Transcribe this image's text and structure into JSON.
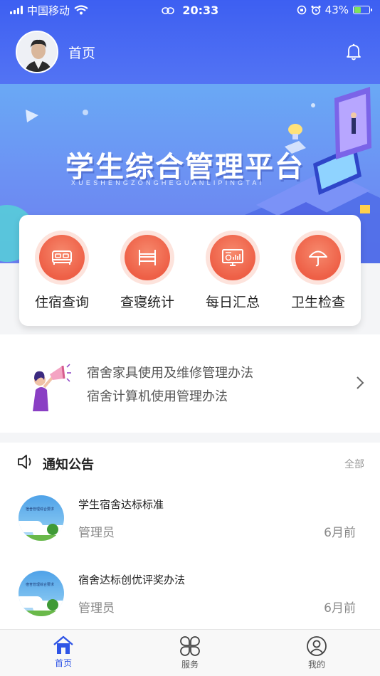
{
  "status_bar": {
    "carrier": "中国移动",
    "time": "20:33",
    "battery": "43%",
    "battery_level": 0.43
  },
  "header": {
    "title": "首页"
  },
  "banner": {
    "title": "学生综合管理平台",
    "subtitle": "XUESHENGZONGHEGUANLIPINGTAI"
  },
  "quick_menu": [
    {
      "label": "住宿查询",
      "icon": "bed-icon"
    },
    {
      "label": "查寝统计",
      "icon": "bunk-bed-icon"
    },
    {
      "label": "每日汇总",
      "icon": "monitor-chart-icon"
    },
    {
      "label": "卫生检查",
      "icon": "umbrella-icon"
    }
  ],
  "rules": {
    "line1": "宿舍家具使用及维修管理办法",
    "line2": "宿舍计算机使用管理办法"
  },
  "notices": {
    "title": "通知公告",
    "all_label": "全部",
    "items": [
      {
        "thumb_label": "宿舍管理综合要求",
        "title": "学生宿舍达标标准",
        "author": "管理员",
        "time": "6月前"
      },
      {
        "thumb_label": "宿舍管理综合要求",
        "title": "宿舍达标创优评奖办法",
        "author": "管理员",
        "time": "6月前"
      }
    ]
  },
  "tabbar": [
    {
      "label": "首页",
      "icon": "home-icon",
      "active": true
    },
    {
      "label": "服务",
      "icon": "grid-flower-icon",
      "active": false
    },
    {
      "label": "我的",
      "icon": "user-icon",
      "active": false
    }
  ],
  "colors": {
    "primary": "#3d5ff2",
    "accent_orange": "#ee5f46",
    "tab_active": "#2f55e6"
  }
}
